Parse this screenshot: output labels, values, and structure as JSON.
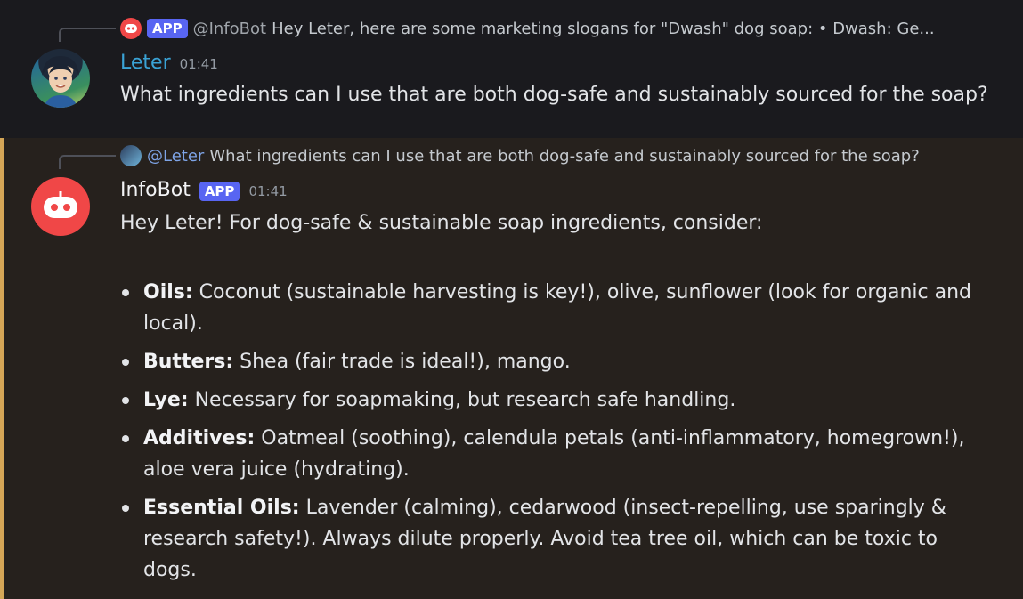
{
  "message1": {
    "reply": {
      "app_tag": "APP",
      "mention": "@InfoBot",
      "text": "Hey Leter, here are some marketing slogans for \"Dwash\" dog soap:  • Dwash: Ge..."
    },
    "author": "Leter",
    "time": "01:41",
    "text": "What ingredients can I use that are both dog-safe and sustainably sourced for the soap?"
  },
  "message2": {
    "reply": {
      "mention": "@Leter",
      "text": "What ingredients can I use that are both dog-safe and sustainably sourced for the soap?"
    },
    "author": "InfoBot",
    "app_tag": "APP",
    "time": "01:41",
    "intro": "Hey Leter! For dog-safe & sustainable soap ingredients, consider:",
    "items": [
      {
        "label": "Oils:",
        "text": " Coconut (sustainable harvesting is key!), olive, sunflower (look for organic and local)."
      },
      {
        "label": "Butters:",
        "text": " Shea (fair trade is ideal!), mango."
      },
      {
        "label": "Lye:",
        "text": " Necessary for soapmaking, but research safe handling."
      },
      {
        "label": "Additives:",
        "text": " Oatmeal (soothing), calendula petals (anti-inflammatory, homegrown!), aloe vera juice (hydrating)."
      },
      {
        "label": "Essential Oils:",
        "text": " Lavender (calming), cedarwood (insect-repelling, use sparingly & research safety!). Always dilute properly. Avoid tea tree oil, which can be toxic to dogs."
      }
    ]
  },
  "colors": {
    "accent_border": "#d4a657",
    "app_tag": "#5865f2",
    "bot_avatar": "#f04747",
    "leter_name": "#3aa3d6"
  },
  "icons": {
    "bot_avatar": "robot-icon",
    "user_avatar": "user-avatar-icon"
  }
}
